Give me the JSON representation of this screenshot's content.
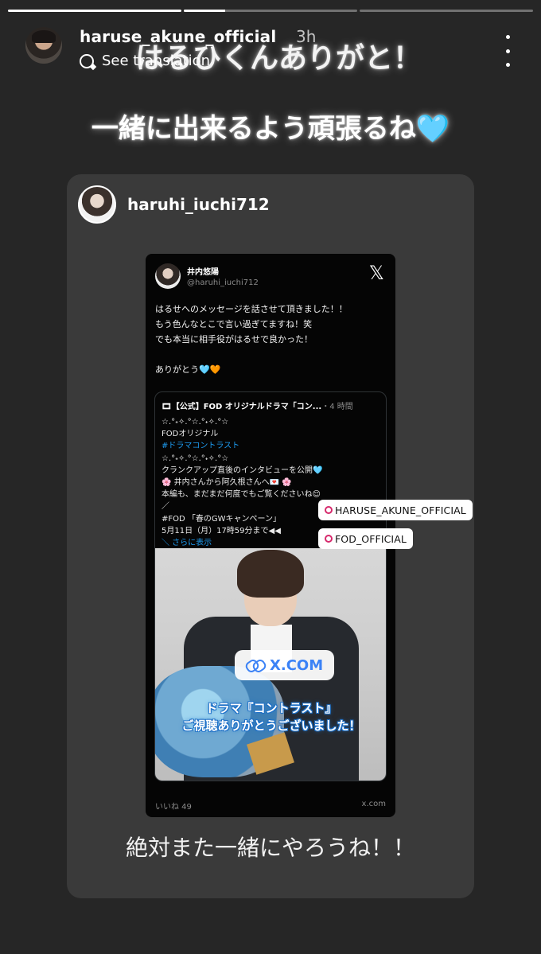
{
  "progress": [
    {
      "fill": 1.0
    },
    {
      "fill": 0.24
    },
    {
      "fill": 0.0
    }
  ],
  "header": {
    "username": "haruse_akune_official",
    "time": "3h",
    "translate_label": "See translation",
    "translate_icon": "translate-icon",
    "more_icon": "more-vertical-icon"
  },
  "captions": {
    "line1": "はるひくんありがと！",
    "line2": "一緒に出来るよう頑張るね🩵"
  },
  "card": {
    "username": "haruhi_iuchi712"
  },
  "tweet": {
    "name": "井内悠陽",
    "handle": "@haruhi_iuchi712",
    "logo": "𝕏",
    "lines": [
      "はるせへのメッセージを話させて頂きました！！",
      "もう色んなとこで言い過ぎてますね！笑",
      "でも本当に相手役がはるせで良かった！",
      "ありがとう🩵🧡"
    ],
    "quote": {
      "header": "🎞【公式】FOD オリジナルドラマ「コン...",
      "time": "・4 時間",
      "lines": [
        "☆.°˖✧.°☆.°˖✧.°☆",
        "FODオリジナル",
        "#ドラマコントラスト",
        "☆.°˖✧.°☆.°˖✧.°☆",
        "クランクアップ直後のインタビューを公開🩵",
        "🌸 井内さんから阿久根さんへ💌 🌸",
        "本編も、まだまだ何度でもご覧くださいね😌",
        "／",
        "#FOD 「春のGWキャンペーン」",
        " 5月11日（月）17時59分まで◀◀",
        "＼ さらに表示"
      ],
      "overlay_line1": "ドラマ『コントラスト』",
      "overlay_line2": "ご視聴ありがとうございました！"
    },
    "likes": "いいね 49",
    "domain": "x.com"
  },
  "stickers": {
    "link_label": "X.COM",
    "mention1": "HARUSE_AKUNE_OFFICIAL",
    "mention2": "FOD_OFFICIAL"
  },
  "bottom_caption": "絶対また一緒にやろうね！！"
}
